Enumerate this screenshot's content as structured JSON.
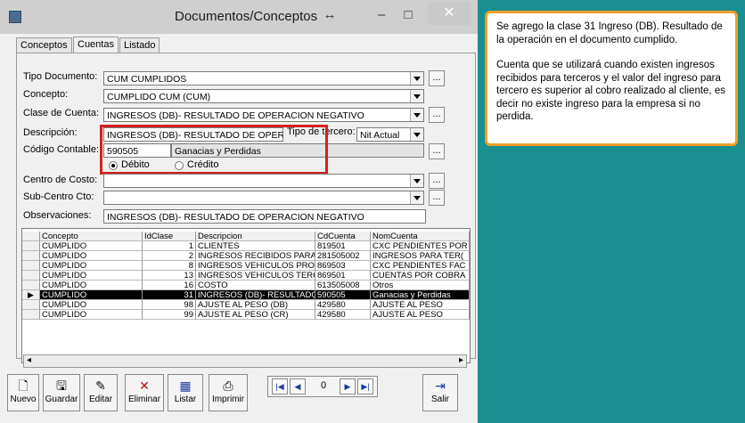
{
  "window": {
    "title": "Documentos/Conceptos",
    "restore_glyph": "↔",
    "min_glyph": "–",
    "max_glyph": "□",
    "close_glyph": "✕"
  },
  "tabs": [
    {
      "label": "Conceptos"
    },
    {
      "label": "Cuentas"
    },
    {
      "label": "Listado"
    }
  ],
  "form": {
    "tipo_documento": {
      "label": "Tipo Documento:",
      "value": "CUM  CUMPLIDOS"
    },
    "concepto": {
      "label": "Concepto:",
      "value": "CUMPLIDO CUM  (CUM)"
    },
    "clase_cuenta": {
      "label": "Clase de Cuenta:",
      "value": "INGRESOS (DB)- RESULTADO DE OPERACION NEGATIVO"
    },
    "descripcion": {
      "label": "Descripción:",
      "value": "INGRESOS (DB)- RESULTADO DE OPERACI"
    },
    "tipo_tercero": {
      "label": "Tipo de tercero:",
      "value": "Nit Actual"
    },
    "codigo_contable": {
      "label": "Código Contable:",
      "code": "590505",
      "name": "Ganacias y Perdidas"
    },
    "debito_label": "Débito",
    "credito_label": "Crédito",
    "centro_costo": {
      "label": "Centro de Costo:",
      "value": ""
    },
    "sub_centro": {
      "label": "Sub-Centro Cto:",
      "value": ""
    },
    "observaciones": {
      "label": "Observaciones:",
      "value": "INGRESOS (DB)- RESULTADO DE OPERACION NEGATIVO"
    },
    "ellipsis": "..."
  },
  "grid": {
    "headers": [
      "Concepto",
      "IdClase",
      "Descripcion",
      "CdCuenta",
      "NomCuenta"
    ],
    "rows": [
      [
        "CUMPLIDO",
        "1",
        "CLIENTES",
        "819501",
        "CXC PENDIENTES POR"
      ],
      [
        "CUMPLIDO",
        "2",
        "INGRESOS RECIBIDOS PARA",
        "281505002",
        "INGRESOS PARA TER("
      ],
      [
        "CUMPLIDO",
        "8",
        "INGRESOS VEHICULOS PROP",
        "869503",
        "CXC PENDIENTES FAC"
      ],
      [
        "CUMPLIDO",
        "13",
        "INGRESOS VEHICULOS TERC",
        "869501",
        "CUENTAS POR COBRA"
      ],
      [
        "CUMPLIDO",
        "16",
        "COSTO",
        "613505008",
        "Otros"
      ],
      [
        "CUMPLIDO",
        "31",
        "INGRESOS (DB)- RESULTADO",
        "590505",
        "Ganacias y Perdidas"
      ],
      [
        "CUMPLIDO",
        "98",
        "AJUSTE AL PESO (DB)",
        "429580",
        "AJUSTE AL PESO"
      ],
      [
        "CUMPLIDO",
        "99",
        "AJUSTE AL PESO (CR)",
        "429580",
        "AJUSTE AL PESO"
      ]
    ]
  },
  "toolbar": {
    "nuevo": "Nuevo",
    "guardar": "Guardar",
    "editar": "Editar",
    "eliminar": "Eliminar",
    "listar": "Listar",
    "imprimir": "Imprimir",
    "salir": "Salir",
    "record_number": "0"
  },
  "note": {
    "p1": "Se agrego la clase 31 Ingreso (DB). Resultado de la operación en el documento cumplido.",
    "p2": "Cuenta que se utilizará cuando existen ingresos recibidos para terceros y  el valor del ingreso para tercero es superior al cobro realizado al cliente, es decir no existe ingreso para la empresa si no perdida."
  }
}
